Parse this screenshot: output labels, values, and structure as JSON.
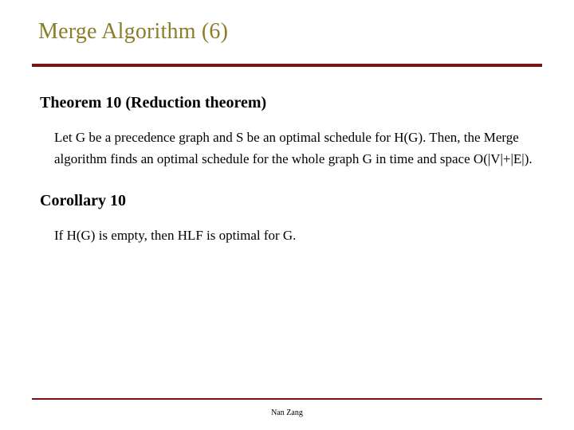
{
  "title": "Merge Algorithm (6)",
  "theorem": {
    "heading": "Theorem 10 (Reduction theorem)",
    "body": "Let G be a precedence graph and S be an optimal schedule for H(G). Then, the Merge algorithm finds an optimal schedule for the whole graph G in time and space O(|V|+|E|)."
  },
  "corollary": {
    "heading": "Corollary 10",
    "body": "If H(G) is empty, then HLF is optimal for G."
  },
  "footer": "Nan Zang"
}
